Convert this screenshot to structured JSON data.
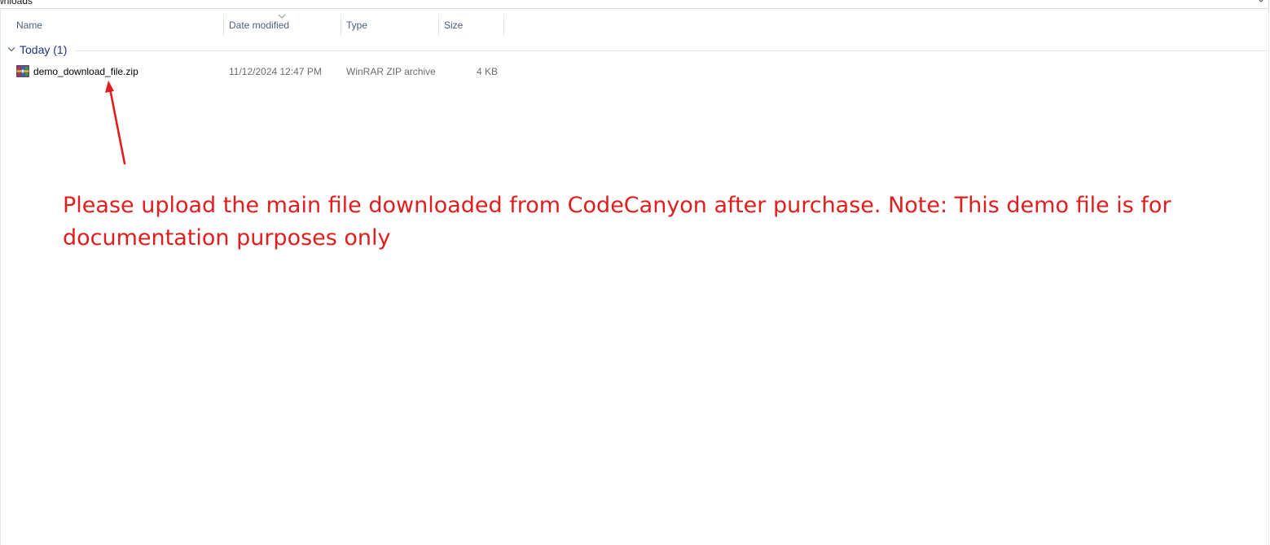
{
  "address_bar": {
    "path_fragment": "wnloads",
    "chevron_icon": "chevron-down-icon"
  },
  "columns": {
    "name": "Name",
    "date_modified": "Date modified",
    "type": "Type",
    "size": "Size",
    "sorted_column": "Date modified",
    "sort_direction": "descending"
  },
  "group": {
    "label": "Today (1)",
    "state": "expanded"
  },
  "files": [
    {
      "name": "demo_download_file.zip",
      "date_modified": "11/12/2024 12:47 PM",
      "type": "WinRAR ZIP archive",
      "size": "4 KB",
      "icon": "winrar-archive-icon"
    }
  ],
  "annotation": {
    "text": "Please upload the main file downloaded from CodeCanyon after purchase. Note: This demo file is for documentation purposes only",
    "color": "#e11d1d",
    "arrow_icon": "red-arrow-annotation"
  },
  "colors": {
    "header_text": "#4c607a",
    "group_text": "#1e3287",
    "secondary_text": "#6d6d6d",
    "annotation_red": "#e11d1d"
  }
}
